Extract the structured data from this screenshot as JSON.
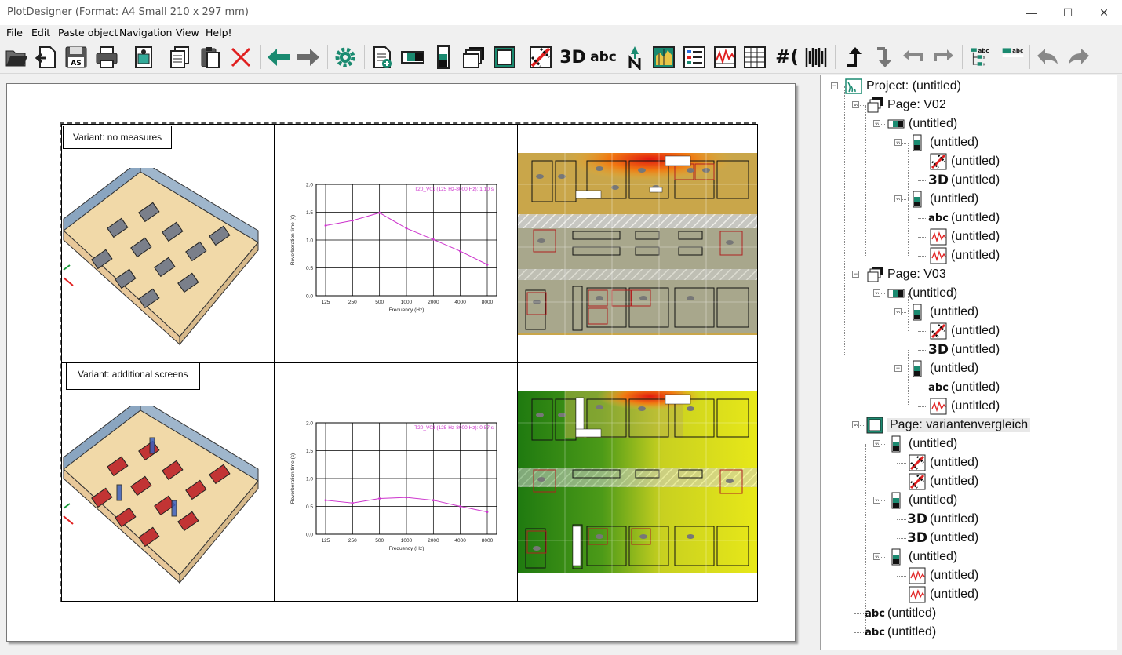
{
  "window": {
    "title": "PlotDesigner (Format: A4 Small 210 x 297 mm)",
    "minimize": "—",
    "maximize": "☐",
    "close": "✕"
  },
  "menu": [
    "File",
    "Edit",
    "Paste object",
    "Navigation",
    "View",
    "Help!"
  ],
  "toolbar": {
    "text_3d": "3D",
    "text_abc": "abc",
    "text_hash": "#("
  },
  "canvas": {
    "variant_1_label": "Variant: no measures",
    "variant_2_label": "Variant: additional screens"
  },
  "chart_data": [
    {
      "type": "line",
      "title": "T20_V01 (125 Hz-8000 Hz): 1,10 s",
      "xlabel": "Frequency (Hz)",
      "ylabel": "Reverberation time (s)",
      "categories": [
        "125",
        "250",
        "500",
        "1000",
        "2000",
        "4000",
        "8000"
      ],
      "values": [
        1.26,
        1.35,
        1.49,
        1.21,
        1.01,
        0.8,
        0.56
      ],
      "yticks": [
        "0.0",
        "0.5",
        "1.0",
        "1.5",
        "2.0"
      ],
      "ylim": [
        0,
        2.0
      ],
      "color": "#cc33cc"
    },
    {
      "type": "line",
      "title": "T20_V03 (125 Hz-8000 Hz): 0,57 s",
      "xlabel": "Frequency (Hz)",
      "ylabel": "Reverberation time (s)",
      "categories": [
        "125",
        "250",
        "500",
        "1000",
        "2000",
        "4000",
        "8000"
      ],
      "values": [
        0.61,
        0.56,
        0.64,
        0.66,
        0.61,
        0.5,
        0.4
      ],
      "yticks": [
        "0.0",
        "0.5",
        "1.0",
        "1.5",
        "2.0"
      ],
      "ylim": [
        0,
        2.0
      ],
      "color": "#cc33cc"
    }
  ],
  "tree": {
    "nodes": [
      {
        "label": "Project: (untitled)",
        "icon": "project-icon"
      },
      {
        "label": "Page: V02",
        "icon": "page-icon"
      },
      {
        "label": "(untitled)",
        "icon": "row-layout-icon"
      },
      {
        "label": "(untitled)",
        "icon": "column-layout-icon"
      },
      {
        "label": "(untitled)",
        "icon": "plan-icon"
      },
      {
        "label": "(untitled)",
        "icon": "3d-icon"
      },
      {
        "label": "(untitled)",
        "icon": "column-layout-icon"
      },
      {
        "label": "(untitled)",
        "icon": "text-icon"
      },
      {
        "label": "(untitled)",
        "icon": "diagram-icon"
      },
      {
        "label": "(untitled)",
        "icon": "diagram-icon"
      },
      {
        "label": "Page: V03",
        "icon": "page-icon"
      },
      {
        "label": "(untitled)",
        "icon": "row-layout-icon"
      },
      {
        "label": "(untitled)",
        "icon": "column-layout-icon"
      },
      {
        "label": "(untitled)",
        "icon": "plan-icon"
      },
      {
        "label": "(untitled)",
        "icon": "3d-icon"
      },
      {
        "label": "(untitled)",
        "icon": "column-layout-icon"
      },
      {
        "label": "(untitled)",
        "icon": "text-icon"
      },
      {
        "label": "(untitled)",
        "icon": "diagram-icon"
      },
      {
        "label": "Page: variantenvergleich",
        "icon": "page-single-icon"
      },
      {
        "label": "(untitled)",
        "icon": "column-layout-icon"
      },
      {
        "label": "(untitled)",
        "icon": "plan-icon"
      },
      {
        "label": "(untitled)",
        "icon": "plan-icon"
      },
      {
        "label": "(untitled)",
        "icon": "column-layout-icon"
      },
      {
        "label": "(untitled)",
        "icon": "3d-icon"
      },
      {
        "label": "(untitled)",
        "icon": "3d-icon"
      },
      {
        "label": "(untitled)",
        "icon": "column-layout-icon"
      },
      {
        "label": "(untitled)",
        "icon": "diagram-icon"
      },
      {
        "label": "(untitled)",
        "icon": "diagram-icon"
      },
      {
        "label": "(untitled)",
        "icon": "text-icon"
      },
      {
        "label": "(untitled)",
        "icon": "text-icon"
      }
    ]
  }
}
